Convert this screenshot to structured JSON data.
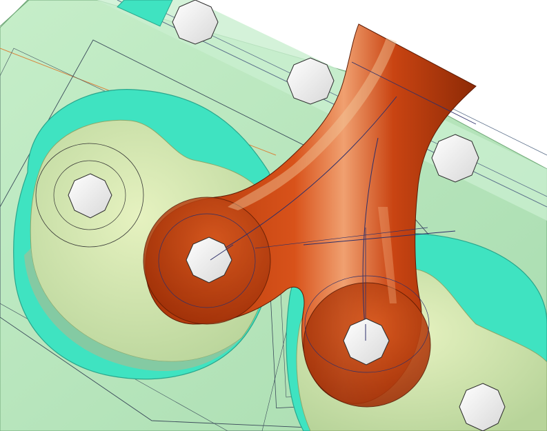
{
  "scene": {
    "description_type": "cad-3d-viewport",
    "colors": {
      "background": "#ffffff",
      "plate": "#b6e6bd",
      "plate_edge": "#6fa777",
      "cavity_cyan": "#3fe3c1",
      "cavity_floor": "#d4eab2",
      "part_red": "#c2400f",
      "part_dark": "#7a2206",
      "part_highlight": "#f2c89c",
      "hole_fill": "#f2f2f2",
      "wire_dark": "#2d2f6a",
      "wire_orange": "#d9823a"
    },
    "icons": {
      "bolt_holes": "hole-icon"
    }
  }
}
